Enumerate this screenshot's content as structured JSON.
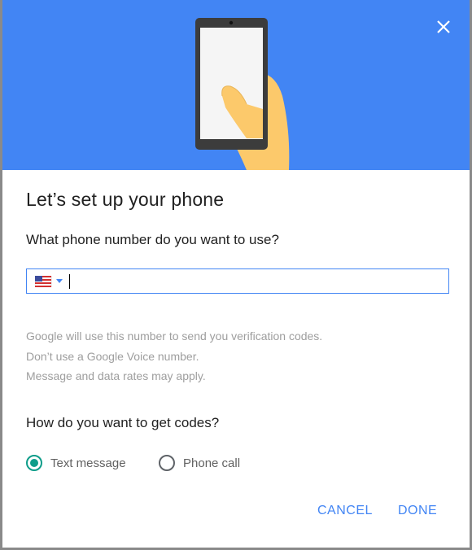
{
  "hero": {
    "close_icon": "close-icon",
    "illustration": "hand-holding-phone"
  },
  "dialog": {
    "title": "Let’s set up your phone",
    "phone_question": "What phone number do you want to use?",
    "phone_input": {
      "value": "",
      "country": "us-flag-icon"
    },
    "help_lines": [
      "Google will use this number to send you verification codes.",
      "Don’t use a Google Voice number.",
      "Message and data rates may apply."
    ],
    "codes_question": "How do you want to get codes?",
    "options": [
      {
        "label": "Text message",
        "selected": true
      },
      {
        "label": "Phone call",
        "selected": false
      }
    ],
    "buttons": {
      "cancel": "CANCEL",
      "done": "DONE"
    }
  },
  "colors": {
    "header": "#4285f4",
    "accent": "#4285f4",
    "radio_selected": "#0f9d8a"
  }
}
